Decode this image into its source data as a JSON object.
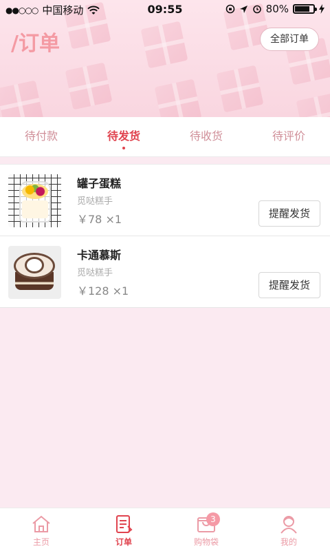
{
  "status_bar": {
    "signal_dots": "●●○○○",
    "carrier": "中国移动",
    "time": "09:55",
    "battery_percent_text": "80%",
    "battery_level": 0.8
  },
  "header": {
    "title": "/订单",
    "all_orders_label": "全部订单"
  },
  "tabs": [
    {
      "label": "待付款",
      "active": false
    },
    {
      "label": "待发货",
      "active": true
    },
    {
      "label": "待收货",
      "active": false
    },
    {
      "label": "待评价",
      "active": false
    }
  ],
  "orders": [
    {
      "name": "罐子蛋糕",
      "shop": "觅哒糕手",
      "price": "￥78  ×1",
      "action": "提醒发货"
    },
    {
      "name": "卡通慕斯",
      "shop": "觅哒糕手",
      "price": "￥128  ×1",
      "action": "提醒发货"
    }
  ],
  "bottom_nav": {
    "items": [
      {
        "label": "主页",
        "icon": "home-icon",
        "active": false
      },
      {
        "label": "订单",
        "icon": "orders-icon",
        "active": true
      },
      {
        "label": "购物袋",
        "icon": "shopping-bag-icon",
        "active": false,
        "badge": "3"
      },
      {
        "label": "我的",
        "icon": "profile-icon",
        "active": false
      }
    ]
  },
  "colors": {
    "accent": "#e0434e",
    "tab_inactive": "#d08f99",
    "title": "#f49aa3",
    "background": "#fbeaf1"
  }
}
